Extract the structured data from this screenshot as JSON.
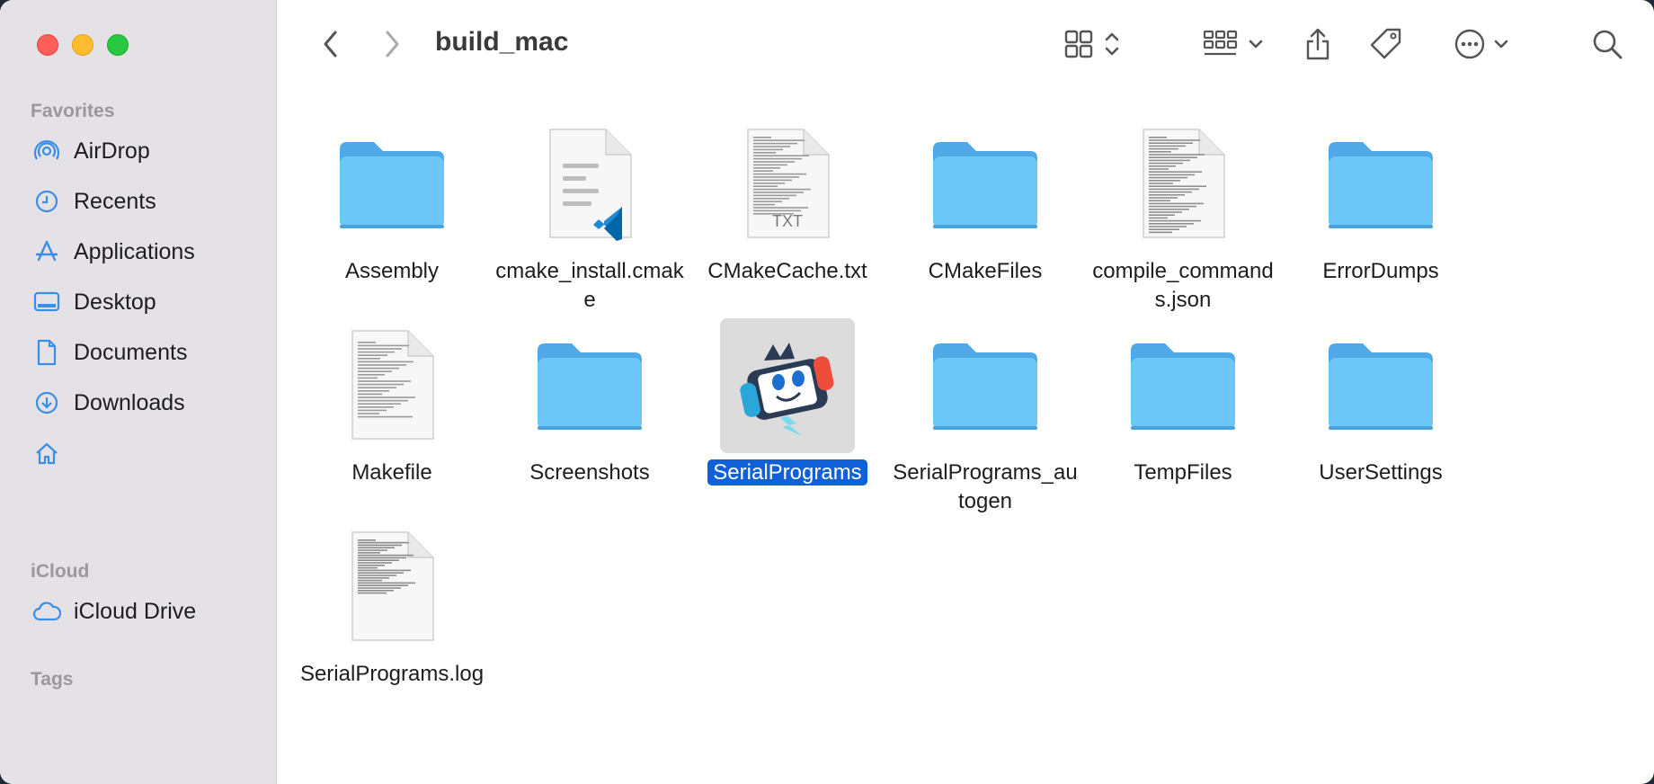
{
  "window": {
    "title": "build_mac"
  },
  "sidebar": {
    "favorites_label": "Favorites",
    "favorites": [
      {
        "label": "AirDrop",
        "icon": "airdrop-icon"
      },
      {
        "label": "Recents",
        "icon": "clock-icon"
      },
      {
        "label": "Applications",
        "icon": "applications-icon"
      },
      {
        "label": "Desktop",
        "icon": "desktop-icon"
      },
      {
        "label": "Documents",
        "icon": "document-icon"
      },
      {
        "label": "Downloads",
        "icon": "download-icon"
      },
      {
        "label": "",
        "icon": "home-icon"
      }
    ],
    "icloud_label": "iCloud",
    "icloud": [
      {
        "label": "iCloud Drive",
        "icon": "cloud-icon"
      }
    ],
    "tags_label": "Tags"
  },
  "toolbar": {
    "back": "chevron-left-icon",
    "forward": "chevron-right-icon",
    "view_mode": "grid-view-icon",
    "group": "group-icon",
    "share": "share-icon",
    "tag": "tag-icon",
    "more": "ellipsis-icon",
    "search": "search-icon"
  },
  "files": [
    {
      "name": "Assembly",
      "type": "folder"
    },
    {
      "name": "cmake_install.cmake",
      "type": "vscode-doc"
    },
    {
      "name": "CMakeCache.txt",
      "type": "txt",
      "badge": "TXT"
    },
    {
      "name": "CMakeFiles",
      "type": "folder"
    },
    {
      "name": "compile_commands.json",
      "type": "dense-doc"
    },
    {
      "name": "ErrorDumps",
      "type": "folder"
    },
    {
      "name": "Makefile",
      "type": "text-doc"
    },
    {
      "name": "Screenshots",
      "type": "folder"
    },
    {
      "name": "SerialPrograms",
      "type": "app",
      "selected": true
    },
    {
      "name": "SerialPrograms_autogen",
      "type": "folder"
    },
    {
      "name": "TempFiles",
      "type": "folder"
    },
    {
      "name": "UserSettings",
      "type": "folder"
    },
    {
      "name": "SerialPrograms.log",
      "type": "log-doc"
    }
  ],
  "colors": {
    "accent": "#1060d8",
    "folder": "#6cc6f7",
    "folder_tab": "#4ea9e6"
  }
}
